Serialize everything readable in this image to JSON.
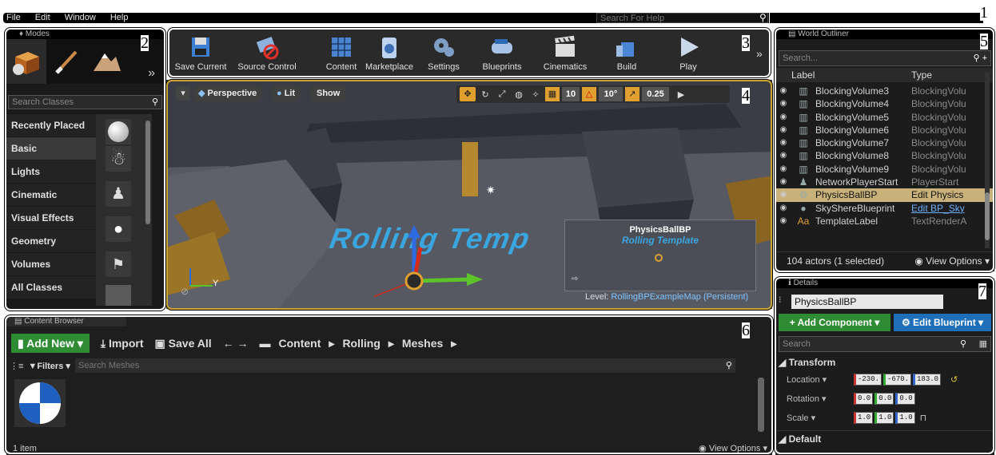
{
  "menu": {
    "items": [
      "File",
      "Edit",
      "Window",
      "Help"
    ],
    "search_placeholder": "Search For Help"
  },
  "markers": [
    "1",
    "2",
    "3",
    "4",
    "5",
    "6",
    "7"
  ],
  "modes": {
    "tab_title": "Modes",
    "search_placeholder": "Search Classes",
    "categories": [
      "Recently Placed",
      "Basic",
      "Lights",
      "Cinematic",
      "Visual Effects",
      "Geometry",
      "Volumes",
      "All Classes"
    ],
    "selected": "Basic"
  },
  "toolbar": {
    "buttons": [
      "Save Current",
      "Source Control",
      "Content",
      "Marketplace",
      "Settings",
      "Blueprints",
      "Cinematics",
      "Build",
      "Play"
    ]
  },
  "viewport": {
    "perspective": "Perspective",
    "lit": "Lit",
    "show": "Show",
    "grid_snap": "10",
    "rot_snap": "10°",
    "scale_snap": "0.25",
    "floor_text": "Rolling Temp",
    "preview_title": "PhysicsBallBP",
    "preview_text": "Rolling Template",
    "level_label": "Level:",
    "level_name": "RollingBPExampleMap (Persistent)",
    "axis_y": "Y"
  },
  "outliner": {
    "tab_title": "World Outliner",
    "search_placeholder": "Search...",
    "col_label": "Label",
    "col_type": "Type",
    "rows": [
      {
        "label": "BlockingVolume3",
        "type": "BlockingVolu"
      },
      {
        "label": "BlockingVolume4",
        "type": "BlockingVolu"
      },
      {
        "label": "BlockingVolume5",
        "type": "BlockingVolu"
      },
      {
        "label": "BlockingVolume6",
        "type": "BlockingVolu"
      },
      {
        "label": "BlockingVolume7",
        "type": "BlockingVolu"
      },
      {
        "label": "BlockingVolume8",
        "type": "BlockingVolu"
      },
      {
        "label": "BlockingVolume9",
        "type": "BlockingVolu"
      },
      {
        "label": "NetworkPlayerStart",
        "type": "PlayerStart"
      },
      {
        "label": "PhysicsBallBP",
        "type": "Edit Physics"
      },
      {
        "label": "SkyShereBlueprint",
        "type": "Edit BP_Sky"
      },
      {
        "label": "TemplateLabel",
        "type": "TextRenderA"
      }
    ],
    "footer": "104 actors (1 selected)",
    "view_options": "View Options"
  },
  "details": {
    "tab_title": "Details",
    "object_name": "PhysicsBallBP",
    "add_component": "+ Add Component",
    "edit_blueprint": "Edit Blueprint",
    "search_placeholder": "Search",
    "section_transform": "Transform",
    "location_label": "Location",
    "location": [
      "-230.",
      "-670.",
      "183.0"
    ],
    "rotation_label": "Rotation",
    "rotation": [
      "0.0",
      "0.0",
      "0.0"
    ],
    "scale_label": "Scale",
    "scale": [
      "1.0",
      "1.0",
      "1.0"
    ],
    "section_default": "Default"
  },
  "content_browser": {
    "tab_title": "Content Browser",
    "add_new": "Add New",
    "import": "Import",
    "save_all": "Save All",
    "path": [
      "Content",
      "Rolling",
      "Meshes"
    ],
    "filters": "Filters",
    "search_placeholder": "Search Meshes",
    "item_count": "1 item",
    "view_options": "View Options"
  },
  "colors": {
    "accent_green": "#2f8c35",
    "details_blue": "#1f6fb8",
    "selection": "#c8b27a",
    "frame": "#ffffff"
  }
}
